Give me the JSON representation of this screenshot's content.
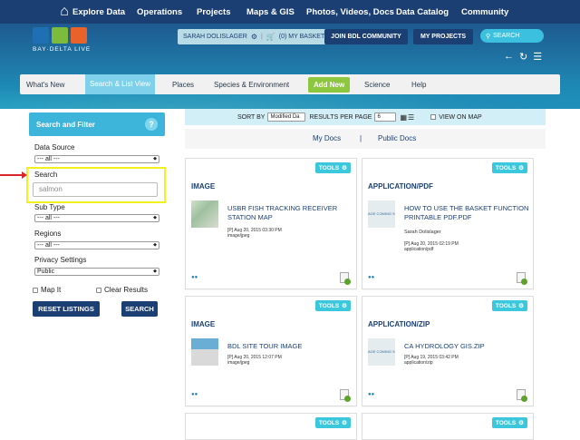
{
  "topnav": {
    "items": [
      "Explore Data",
      "Operations",
      "Projects",
      "Maps & GIS",
      "Photos, Videos, Docs",
      "Data Catalog",
      "Community"
    ]
  },
  "header": {
    "logo_text": "BAY·DELTA LIVE",
    "user": "SARAH DOLISLAGER",
    "basket": "(0) MY BASKET",
    "join": "JOIN BDL COMMUNITY",
    "projects": "MY PROJECTS",
    "search": "SEARCH"
  },
  "subnav": {
    "items": [
      "What's New",
      "Search & List View",
      "Places",
      "Species & Environment",
      "Add New",
      "Science",
      "Help"
    ]
  },
  "sidebar": {
    "title": "Search and Filter",
    "help": "?",
    "data_source_label": "Data Source",
    "data_source_value": "--- all ---",
    "search_label": "Search",
    "search_value": "salmon",
    "sub_type_label": "Sub Type",
    "sub_type_value": "--- all ---",
    "regions_label": "Regions",
    "regions_value": "--- all ---",
    "privacy_label": "Privacy Settings",
    "privacy_value": "Public",
    "map_it": "Map It",
    "clear_results": "Clear Results",
    "reset": "RESET LISTINGS",
    "search_btn": "SEARCH"
  },
  "sortbar": {
    "sort_by": "SORT BY",
    "sort_value": "Modified Da",
    "results_per_page": "RESULTS PER PAGE",
    "rpp_value": "6",
    "view_on_map": "VIEW ON MAP"
  },
  "doctabs": {
    "my_docs": "My Docs",
    "sep": "|",
    "public_docs": "Public Docs"
  },
  "cards": [
    {
      "tools": "TOOLS",
      "type": "IMAGE",
      "title": "USBR FISH TRACKING RECEIVER STATION MAP",
      "author": "",
      "date": "[P] Aug 20, 2015 03:30 PM",
      "mime": "image/jpeg",
      "thumb_text": ""
    },
    {
      "tools": "TOOLS",
      "type": "APPLICATION/PDF",
      "title": "HOW TO USE THE BASKET FUNCTION PRINTABLE PDF.PDF",
      "author": "Sarah Dolislager",
      "date": "[P] Aug 20, 2015 02:19 PM",
      "mime": "application/pdf",
      "thumb_text": "AGE COMING SO"
    },
    {
      "tools": "TOOLS",
      "type": "IMAGE",
      "title": "BDL SITE TOUR IMAGE",
      "author": "",
      "date": "[P] Aug 20, 2015 12:07 PM",
      "mime": "image/jpeg",
      "thumb_text": ""
    },
    {
      "tools": "TOOLS",
      "type": "APPLICATION/ZIP",
      "title": "CA HYDROLOGY GIS.ZIP",
      "author": "",
      "date": "[P] Aug 19, 2015 03:42 PM",
      "mime": "application/zip",
      "thumb_text": "AGE COMING SC"
    },
    {
      "tools": "TOOLS"
    },
    {
      "tools": "TOOLS"
    }
  ],
  "colors": {
    "navy": "#1c3f73",
    "teal": "#3db4da",
    "green": "#8dc63f",
    "highlight": "#f2f01e",
    "arrow": "#d9262a"
  }
}
